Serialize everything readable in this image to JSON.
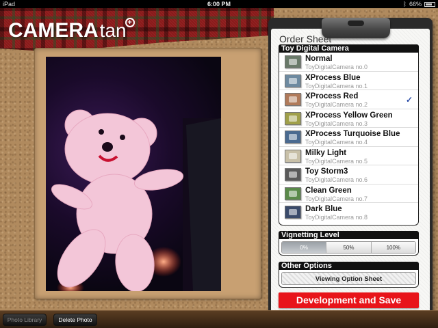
{
  "status_bar": {
    "device": "iPad",
    "time": "6:00 PM",
    "battery": "66%"
  },
  "app": {
    "logo_bold": "CAMERA",
    "logo_light": "tan",
    "logo_plus": "+"
  },
  "order_sheet": {
    "title": "Order Sheet",
    "camera_section": "Toy Digital Camera",
    "items": [
      {
        "name": "Normal",
        "sub": "ToyDigitalCamera no.0",
        "color": "#6a7a6a"
      },
      {
        "name": "XProcess Blue",
        "sub": "ToyDigitalCamera no.1",
        "color": "#6e8aa0"
      },
      {
        "name": "XProcess Red",
        "sub": "ToyDigitalCamera no.2",
        "color": "#b07a5a"
      },
      {
        "name": "XProcess Yellow Green",
        "sub": "ToyDigitalCamera no.3",
        "color": "#a0a04a"
      },
      {
        "name": "XProcess Turquoise Blue",
        "sub": "ToyDigitalCamera no.4",
        "color": "#4a6a90"
      },
      {
        "name": "Milky Light",
        "sub": "ToyDigitalCamera no.5",
        "color": "#c8c0a8"
      },
      {
        "name": "Toy Storm3",
        "sub": "ToyDigitalCamera no.6",
        "color": "#5a5a5a"
      },
      {
        "name": "Clean Green",
        "sub": "ToyDigitalCamera no.7",
        "color": "#5a8a4a"
      },
      {
        "name": "Dark Blue",
        "sub": "ToyDigitalCamera no.8",
        "color": "#3a4a6a"
      }
    ],
    "selected_check": "✓",
    "vignetting_section": "Vignetting Level",
    "vignetting_options": [
      "0%",
      "50%",
      "100%"
    ],
    "other_section": "Other Options",
    "viewing_option": "Viewing Option Sheet",
    "dev_save": "Development and Save"
  },
  "toolbar": {
    "photo_library": "Photo Library",
    "delete_photo": "Delete Photo"
  },
  "colors": {
    "accent_red": "#e8141a",
    "check_blue": "#2d4fa8"
  }
}
